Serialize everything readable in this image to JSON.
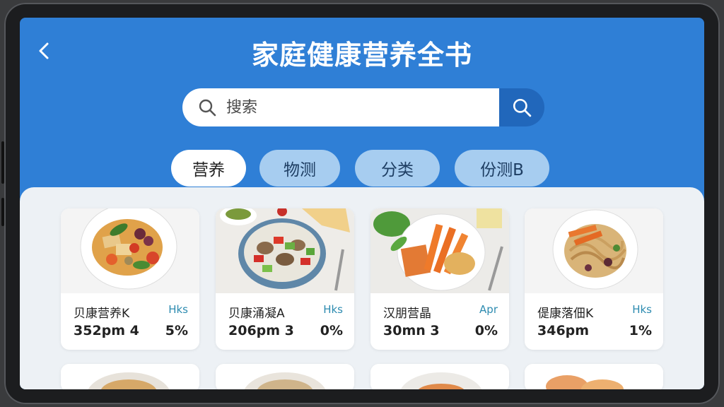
{
  "header": {
    "title": "家庭健康营养全书",
    "back_icon": "chevron-left-icon"
  },
  "search": {
    "placeholder": "搜索",
    "icon": "search-icon",
    "button_icon": "search-icon"
  },
  "tabs": [
    {
      "label": "营养",
      "active": true
    },
    {
      "label": "物测",
      "active": false
    },
    {
      "label": "分类",
      "active": false
    },
    {
      "label": "份测B",
      "active": false
    }
  ],
  "cards": [
    {
      "name": "贝康营养K",
      "tag": "Hks",
      "value": "352pm 4",
      "percent": "5%"
    },
    {
      "name": "贝康涌凝A",
      "tag": "Hks",
      "value": "206pm 3",
      "percent": "0%"
    },
    {
      "name": "汉朋营晶",
      "tag": "Apr",
      "value": "30mn 3",
      "percent": "0%"
    },
    {
      "name": "偍康落佃K",
      "tag": "Hks",
      "value": "346pm",
      "percent": "1%"
    }
  ],
  "colors": {
    "header_bg": "#2f7fd6",
    "search_button": "#2167bb",
    "tab_inactive": "#a7cdf0",
    "panel_bg": "#edf1f5"
  }
}
